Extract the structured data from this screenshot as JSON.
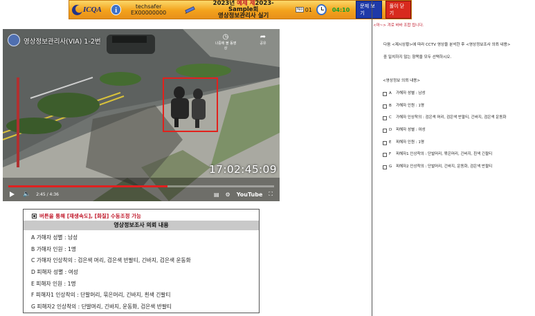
{
  "banner": {
    "logo_text": "ICQA",
    "user_id": "techsafer",
    "user_code": "EX00000000",
    "exam_line1_prefix": "2023년 ",
    "exam_line1_red": "예제 제",
    "exam_line1_suffix": "2023-Sample회",
    "exam_line2": "영상정보관리사 실기",
    "question_no": "01",
    "timer": "04:10",
    "show_problem_button": "문제 보기",
    "close_button": "풀이 닫기"
  },
  "video": {
    "title": "영상정보관리사(VIA) 1-2번",
    "watch_later_label": "나중에 볼 동영상",
    "share_label": "공유",
    "timestamp_overlay": "17:02:45:09",
    "current_time": "2:45 / 4:36",
    "progress_fraction": 0.6,
    "youtube_label": "YouTube"
  },
  "panel": {
    "hint": "버튼을 통해 [재생속도], [화질] 수동조정 가능",
    "header": "영상정보조사 의뢰 내용",
    "items": [
      "A 가해자 성별 : 남성",
      "B 가해자 인원 : 1명",
      "C 가해자 인상착의 : 검은색 머리, 검은색 반팔티, 긴바지, 검은색 운동화",
      "D 피해자 성별 : 여성",
      "E 피해자 인원 : 1명",
      "F 피해자1 인상착의 : 단발머리, 묶은머리, 긴바지, 흰색 긴팔티",
      "G 피해자2 인상착의 : 단발머리, 긴바지, 운동화, 검은색 반팔티"
    ]
  },
  "question": {
    "header": "<마~> 겨로 바바 조합 됩니다.",
    "text_line1": "다음 <제시상황>에 따라 CCTV 영상을 분석한 후 <영상정보조사 의뢰 내용>",
    "text_line2": "중 일치하지 않는 항목을 모두 선택하시오.",
    "info_label": "<영상정보 의뢰 내용>",
    "options": [
      {
        "letter": "A",
        "text": "가해자 성별 : 남성"
      },
      {
        "letter": "B",
        "text": "가해자 인원 : 1명"
      },
      {
        "letter": "C",
        "text": "가해자 인상착의 : 검은색 머리, 검은색 반팔티, 긴바지, 검은색 운동화"
      },
      {
        "letter": "D",
        "text": "피해자 성별 : 여성"
      },
      {
        "letter": "E",
        "text": "피해자 인원 : 1명"
      },
      {
        "letter": "F",
        "text": "피해자1 인상착의 : 단발머리, 묶은머리, 긴바지, 흰색 긴팔티"
      },
      {
        "letter": "G",
        "text": "피해자2 인상착의 : 단발머리, 긴바지, 운동화, 검은색 반팔티"
      }
    ]
  },
  "colors": {
    "accent_red": "#c0182a",
    "banner_orange": "#f3a21c",
    "timer_green": "#12a12e",
    "button_blue": "#1f3aa8",
    "selection_red": "#e2211c"
  }
}
